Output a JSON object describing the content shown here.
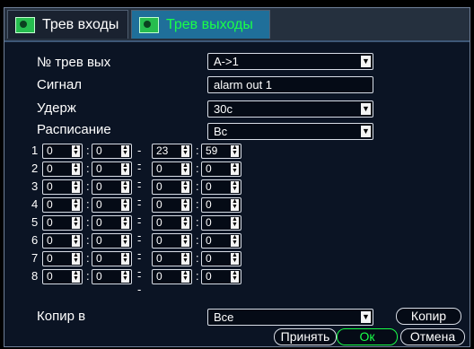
{
  "tabs": [
    {
      "label": "Трев входы"
    },
    {
      "label": "Трев выходы"
    }
  ],
  "form": {
    "alarm_out_no_label": "№ трев вых",
    "alarm_out_no_value": "A->1",
    "signal_label": "Сигнал",
    "signal_value": "alarm out 1",
    "hold_label": "Удерж",
    "hold_value": "30с",
    "schedule_label": "Расписание",
    "schedule_value": "Вс"
  },
  "schedule_rows": [
    {
      "n": "1",
      "start_h": "0",
      "start_m": "0",
      "end_h": "23",
      "end_m": "59"
    },
    {
      "n": "2",
      "start_h": "0",
      "start_m": "0",
      "end_h": "0",
      "end_m": "0"
    },
    {
      "n": "3",
      "start_h": "0",
      "start_m": "0",
      "end_h": "0",
      "end_m": "0"
    },
    {
      "n": "4",
      "start_h": "0",
      "start_m": "0",
      "end_h": "0",
      "end_m": "0"
    },
    {
      "n": "5",
      "start_h": "0",
      "start_m": "0",
      "end_h": "0",
      "end_m": "0"
    },
    {
      "n": "6",
      "start_h": "0",
      "start_m": "0",
      "end_h": "0",
      "end_m": "0"
    },
    {
      "n": "7",
      "start_h": "0",
      "start_m": "0",
      "end_h": "0",
      "end_m": "0"
    },
    {
      "n": "8",
      "start_h": "0",
      "start_m": "0",
      "end_h": "0",
      "end_m": "0"
    }
  ],
  "copy": {
    "label": "Копир в",
    "target_value": "Все",
    "button_label": "Копир"
  },
  "footer": {
    "apply_label": "Принять",
    "ok_label": "Ок",
    "cancel_label": "Отмена"
  },
  "colors": {
    "background": "#0b1424",
    "active_tab": "#1f6f9a",
    "accent_green": "#19ff48"
  }
}
